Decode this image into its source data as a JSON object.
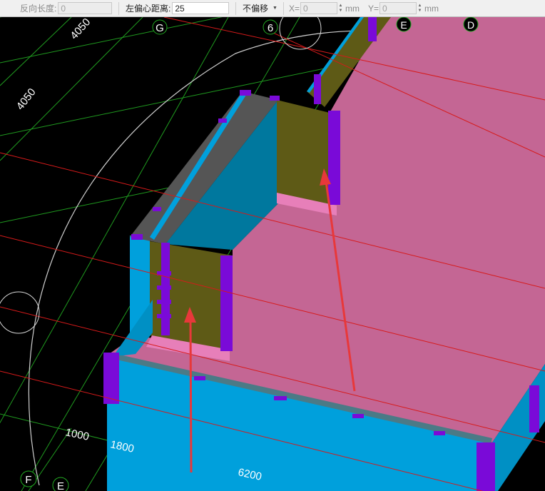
{
  "toolbar": {
    "reverse_length_label": "反向长度:",
    "reverse_length_value": "0",
    "left_offset_label": "左偏心距离:",
    "left_offset_value": "25",
    "offset_mode": "不偏移",
    "x_label": "X=",
    "x_value": "0",
    "x_unit": "mm",
    "y_label": "Y=",
    "y_value": "0",
    "y_unit": "mm"
  },
  "axes": {
    "top": [
      "G",
      "6",
      "E",
      "D"
    ],
    "left": [
      "F",
      "E"
    ]
  },
  "dimensions": {
    "d1": "4050",
    "d2": "4050",
    "d3": "1000",
    "d4": "1800",
    "d5": "6200"
  },
  "colors": {
    "background": "#000000",
    "slab": "#c46694",
    "wall_cyan": "#00a0dc",
    "wall_olive": "#5e5a16",
    "column_purple": "#7a0ad8",
    "annotation_arrow": "#e8383a"
  }
}
